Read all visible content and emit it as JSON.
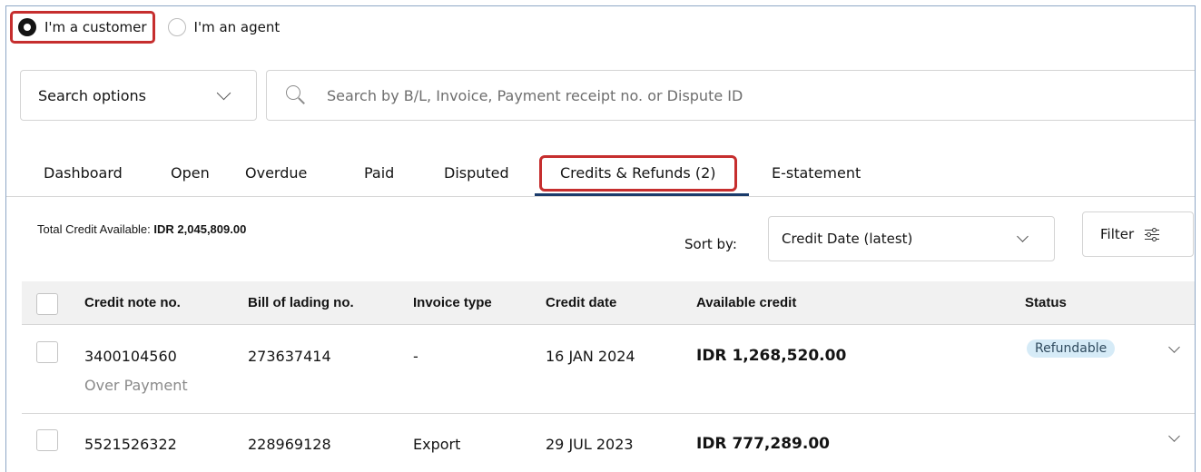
{
  "role_selector": {
    "customer_label": "I'm a customer",
    "agent_label": "I'm an agent",
    "selected": "customer"
  },
  "search": {
    "options_label": "Search options",
    "placeholder": "Search by B/L, Invoice, Payment receipt no. or Dispute ID"
  },
  "tabs": [
    {
      "label": "Dashboard"
    },
    {
      "label": "Open"
    },
    {
      "label": "Overdue"
    },
    {
      "label": "Paid"
    },
    {
      "label": "Disputed"
    },
    {
      "label": "Credits & Refunds  (2)",
      "active": true
    },
    {
      "label": "E-statement"
    }
  ],
  "summary": {
    "total_label": "Total Credit Available:",
    "total_value": "IDR 2,045,809.00"
  },
  "sort": {
    "label": "Sort by:",
    "selected": "Credit Date (latest)"
  },
  "filter": {
    "label": "Filter"
  },
  "table": {
    "columns": [
      "Credit note no.",
      "Bill of lading no.",
      "Invoice type",
      "Credit date",
      "Available credit",
      "Status"
    ],
    "rows": [
      {
        "credit_note": "3400104560",
        "reason": "Over Payment",
        "bill_of_lading": "273637414",
        "invoice_type": "-",
        "credit_date": "16 JAN 2024",
        "available_credit": "IDR 1,268,520.00",
        "status": "Refundable"
      },
      {
        "credit_note": "5521526322",
        "bill_of_lading": "228969128",
        "invoice_type": "Export",
        "credit_date": "29 JUL 2023",
        "available_credit": "IDR 777,289.00"
      }
    ]
  },
  "colors": {
    "highlight": "#c62e2e",
    "tab_underline": "#1a3b6b",
    "badge_bg": "#d6ebf7",
    "header_bg": "#f1f1f1"
  },
  "icons": [
    "radio-selected-icon",
    "radio-unselected-icon",
    "chevron-down-icon",
    "search-icon",
    "filter-sliders-icon",
    "checkbox-icon"
  ]
}
